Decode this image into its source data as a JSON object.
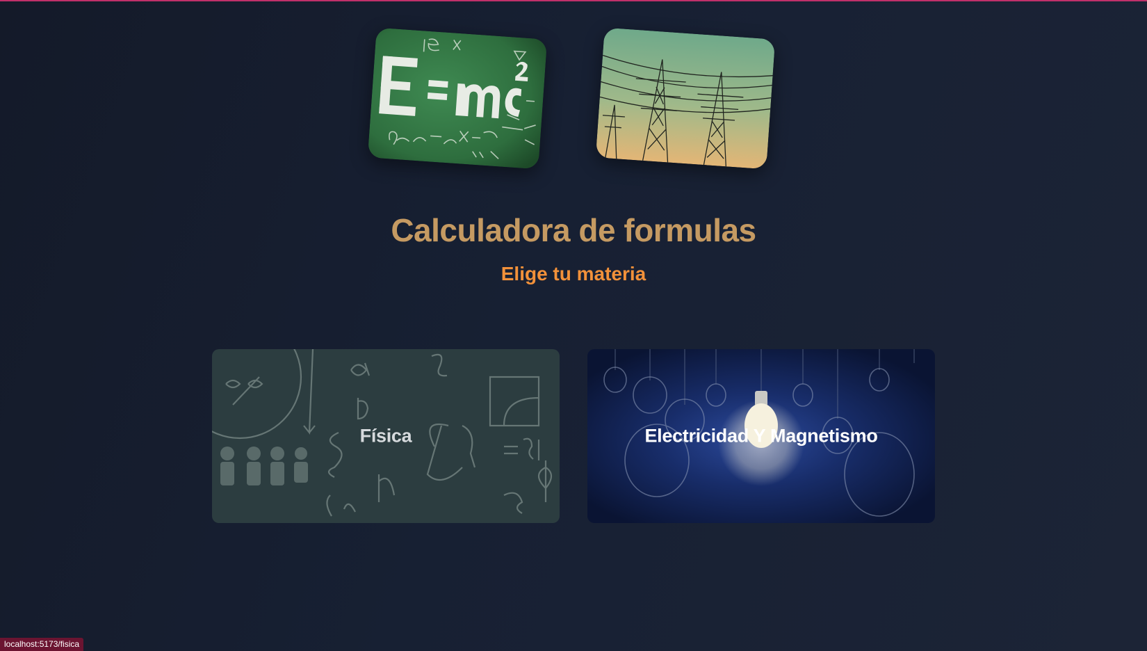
{
  "header": {
    "title": "Calculadora de formulas",
    "subtitle": "Elige tu materia"
  },
  "hero_images": [
    {
      "name": "chalkboard-formula-image",
      "depicts": "E = mc² chalkboard"
    },
    {
      "name": "power-lines-image",
      "depicts": "electric transmission towers"
    }
  ],
  "cards": [
    {
      "label": "Física",
      "link": "localhost:5173/fisica"
    },
    {
      "label": "Electricidad Y Magnetismo"
    }
  ],
  "status_bar": {
    "url": "localhost:5173/fisica"
  },
  "colors": {
    "background": "#172033",
    "title": "#c59a62",
    "subtitle": "#f2913a",
    "accent_line": "#c0306a",
    "status_bg": "#6b1431"
  }
}
